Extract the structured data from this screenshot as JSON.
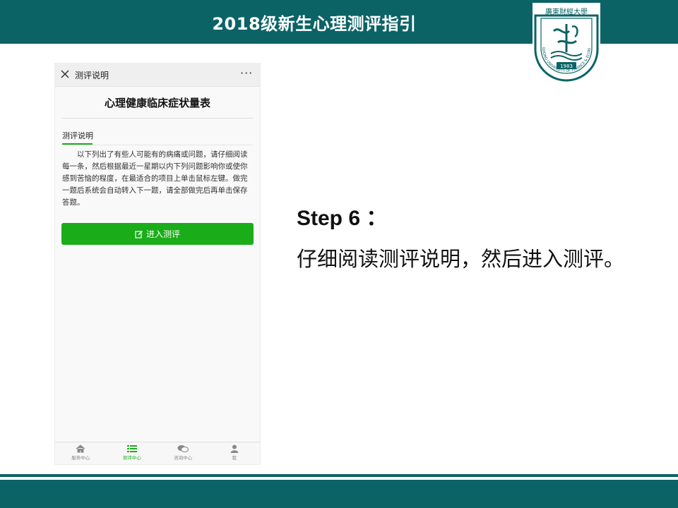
{
  "slide": {
    "title": "2018级新生心理测评指引",
    "step_title": "Step 6 ：",
    "step_desc": "仔细阅读测评说明，然后进入测评。"
  },
  "logo": {
    "text_top": "廣東財經大學",
    "text_ring": "GUANGDONG UNIVERSITY OF FINANCE & ECONOMICS",
    "year": "1983"
  },
  "phone": {
    "header_title": "测评说明",
    "more": "···",
    "scale_title": "心理健康临床症状量表",
    "tab_label": "测评说明",
    "instructions": "以下列出了有些人可能有的病痛或问题，请仔细阅读每一条，然后根据最近一星期以内下列问题影响你或使你感到苦恼的程度，在最适合的项目上单击鼠标左键。做完一题后系统会自动转入下一题，请全部做完后再单击保存答题。",
    "enter_button": "进入测评",
    "tabbar": [
      {
        "label": "服务中心",
        "icon": "home-icon"
      },
      {
        "label": "测评中心",
        "icon": "list-icon"
      },
      {
        "label": "咨询中心",
        "icon": "chat-icon"
      },
      {
        "label": "我",
        "icon": "user-icon"
      }
    ]
  },
  "colors": {
    "brand_teal": "#0b6366",
    "accent_green": "#1aad19"
  }
}
